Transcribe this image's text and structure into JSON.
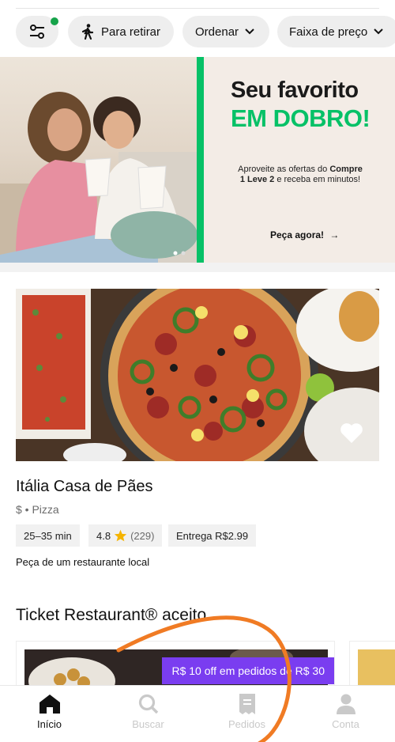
{
  "filters": {
    "pickup_label": "Para retirar",
    "order_label": "Ordenar",
    "price_label": "Faixa de preço"
  },
  "banner": {
    "title_line1": "Seu favorito",
    "title_line2": "EM DOBRO!",
    "sub_pre": "Aproveite as ofertas do ",
    "sub_bold": "Compre 1 Leve 2",
    "sub_post": " e receba em minutos!",
    "cta": "Peça agora!",
    "cta_arrow": "→",
    "accent_color": "#06c167"
  },
  "restaurant": {
    "name": "Itália Casa de Pães",
    "meta": "$ • Pizza",
    "time": "25–35 min",
    "rating": "4.8",
    "rating_count": "(229)",
    "delivery": "Entrega R$2.99",
    "local_label": "Peça de um restaurante local"
  },
  "section": {
    "title": "Ticket Restaurant® aceito",
    "promo": "R$ 10 off em pedidos de R$ 30",
    "promo_color": "#7a3df0"
  },
  "nav": {
    "items": [
      {
        "label": "Início",
        "icon": "home-icon",
        "active": true
      },
      {
        "label": "Buscar",
        "icon": "search-icon",
        "active": false
      },
      {
        "label": "Pedidos",
        "icon": "receipt-icon",
        "active": false
      },
      {
        "label": "Conta",
        "icon": "person-icon",
        "active": false
      }
    ]
  }
}
